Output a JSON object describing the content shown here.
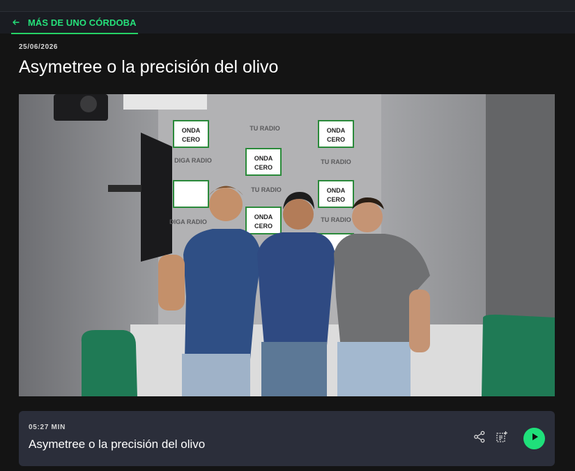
{
  "nav": {
    "back_icon": "arrow-left-icon",
    "back_label": "MÁS DE UNO CÓRDOBA",
    "accent_color": "#25d366"
  },
  "article": {
    "date": "25/06/2026",
    "title": "Asymetree o la precisión del olivo"
  },
  "photo": {
    "logo_line1": "ONDA",
    "logo_line2": "CERO",
    "wall_text_1": "TU RADIO",
    "wall_text_2": "DIGA RADIO"
  },
  "player": {
    "duration": "05:27 MIN",
    "title": "Asymetree o la precisión del olivo",
    "share_icon": "share-icon",
    "playlist_icon": "add-to-playlist-icon",
    "play_icon": "play-icon",
    "play_color": "#1fe07a"
  }
}
